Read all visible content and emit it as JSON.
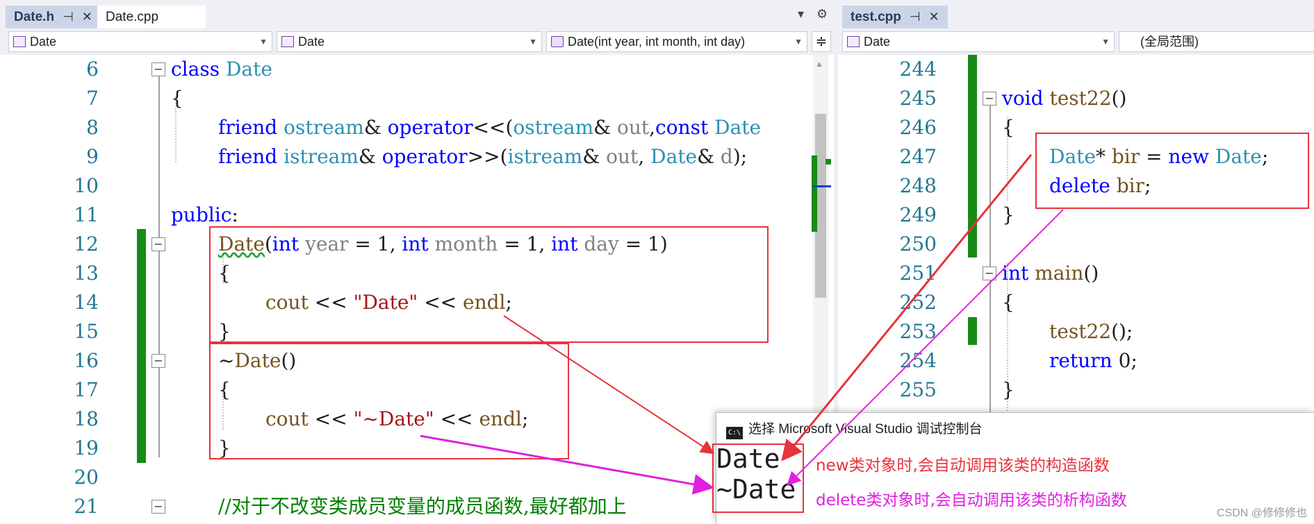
{
  "left": {
    "tabs": [
      {
        "label": "Date.h",
        "pin": "⊣",
        "close": "✕"
      },
      {
        "label": "Date.cpp"
      }
    ],
    "tab_dropdown": "▾",
    "tab_settings": "⚙",
    "nav": {
      "scope": "Date",
      "class": "Date",
      "member": "Date(int year, int month, int day)",
      "split": "≑"
    },
    "line_numbers": [
      "6",
      "7",
      "8",
      "9",
      "10",
      "11",
      "12",
      "13",
      "14",
      "15",
      "16",
      "17",
      "18",
      "19",
      "20",
      "21"
    ]
  },
  "right": {
    "tabs": [
      {
        "label": "test.cpp",
        "pin": "⊣",
        "close": "✕"
      }
    ],
    "nav": {
      "scope": "Date",
      "member": "(全局范围)"
    },
    "line_numbers": [
      "244",
      "245",
      "246",
      "247",
      "248",
      "249",
      "250",
      "251",
      "252",
      "253",
      "254",
      "255"
    ]
  },
  "console": {
    "title": "选择 Microsoft Visual Studio 调试控制台",
    "icon_label": "C:\\",
    "output": [
      "Date",
      "~Date"
    ],
    "note_ctor": "new类对象时,会自动调用该类的构造函数",
    "note_dtor": "delete类对象时,会自动调用该类的析构函数"
  },
  "watermark": "CSDN @修修修也",
  "colors": {
    "keyword": "#0000ff",
    "type": "#2b91af",
    "function": "#74531f",
    "string": "#a31515",
    "comment": "#008000",
    "annotation_red": "#e8323c",
    "annotation_magenta": "#e020e0",
    "change_bar": "#168b16"
  }
}
